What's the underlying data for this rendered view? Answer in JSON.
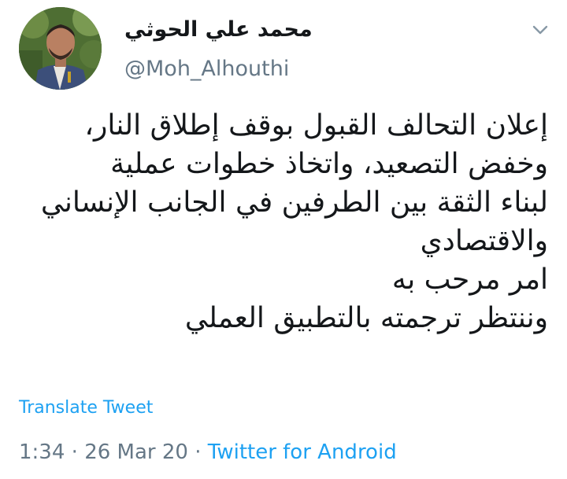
{
  "author": {
    "display_name": "محمد علي الحوثي",
    "handle": "@Moh_Alhouthi"
  },
  "tweet": {
    "lines": [
      "إعلان التحالف القبول بوقف إطلاق النار،",
      "وخفض التصعيد، واتخاذ خطوات عملية",
      "لبناء الثقة بين الطرفين في الجانب الإنساني",
      "والاقتصادي",
      "امر مرحب به",
      "وننتظر ترجمته بالتطبيق العملي"
    ],
    "translate_label": "Translate Tweet",
    "time": "1:34",
    "date": "26 Mar 20",
    "separator": " · ",
    "source": "Twitter for Android"
  },
  "icons": {
    "avatar": "profile-photo",
    "menu": "chevron-down-icon"
  },
  "colors": {
    "text": "#14171a",
    "secondary": "#657786",
    "link": "#1da1f2"
  }
}
